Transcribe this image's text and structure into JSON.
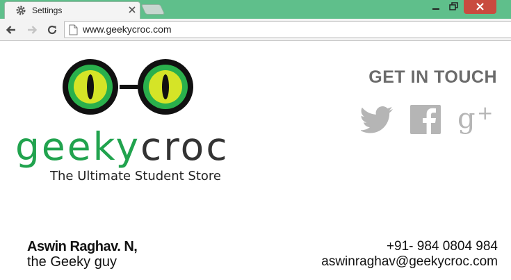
{
  "browser": {
    "tab_title": "Settings",
    "url": "www.geekycroc.com"
  },
  "page": {
    "brand": {
      "part1": "geeky",
      "part2": "croc"
    },
    "tagline": "The Ultimate Student Store",
    "get_in_touch": "GET IN TOUCH",
    "social_icons": [
      "twitter-icon",
      "facebook-icon",
      "google-plus-icon"
    ],
    "person": {
      "name": "Aswin Raghav. N,",
      "role": "the Geeky guy"
    },
    "contact": {
      "phone": "+91- 984 0804 984",
      "email": "aswinraghav@geekycroc.com"
    }
  },
  "colors": {
    "titlebar": "#5fbf8b",
    "brand_green": "#21a34e",
    "social_grey": "#b5b5b5",
    "close_red": "#c94b3f"
  }
}
